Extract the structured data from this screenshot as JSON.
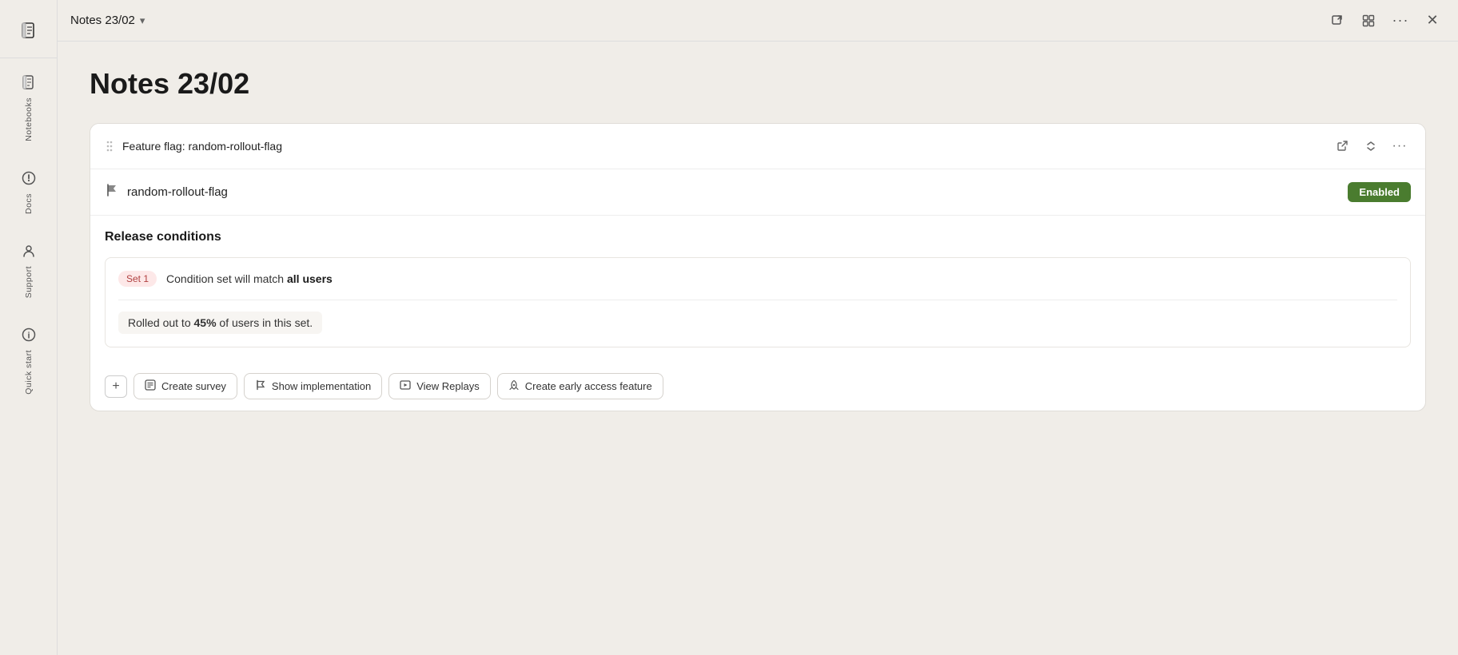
{
  "sidebar": {
    "logo_label": "Notebooks",
    "nav_items": [
      {
        "id": "notebooks",
        "label": "Notebooks",
        "icon": "📓"
      },
      {
        "id": "docs",
        "label": "Docs",
        "icon": "📄"
      },
      {
        "id": "support",
        "label": "Support",
        "icon": "👤"
      },
      {
        "id": "quick_start",
        "label": "Quick start",
        "icon": "ℹ"
      }
    ]
  },
  "topbar": {
    "title": "Notes 23/02",
    "actions": {
      "external_link_label": "external link",
      "grid_label": "grid view",
      "more_label": "more options",
      "close_label": "close"
    }
  },
  "page": {
    "title": "Notes 23/02"
  },
  "card": {
    "header_title": "Feature flag: random-rollout-flag",
    "flag_name": "random-rollout-flag",
    "enabled_badge": "Enabled",
    "release_conditions_title": "Release conditions",
    "set_badge": "Set 1",
    "condition_text_prefix": "Condition set will match ",
    "condition_text_bold": "all users",
    "rollout_text_prefix": "Rolled out to ",
    "rollout_percent": "45%",
    "rollout_text_suffix": " of users in this set."
  },
  "toolbar": {
    "add_label": "+",
    "create_survey_label": "Create survey",
    "show_implementation_label": "Show implementation",
    "view_replays_label": "View Replays",
    "create_early_access_label": "Create early access feature"
  },
  "colors": {
    "enabled_bg": "#4a7c2f",
    "set_badge_bg": "#fde8e8",
    "set_badge_color": "#b04040"
  }
}
